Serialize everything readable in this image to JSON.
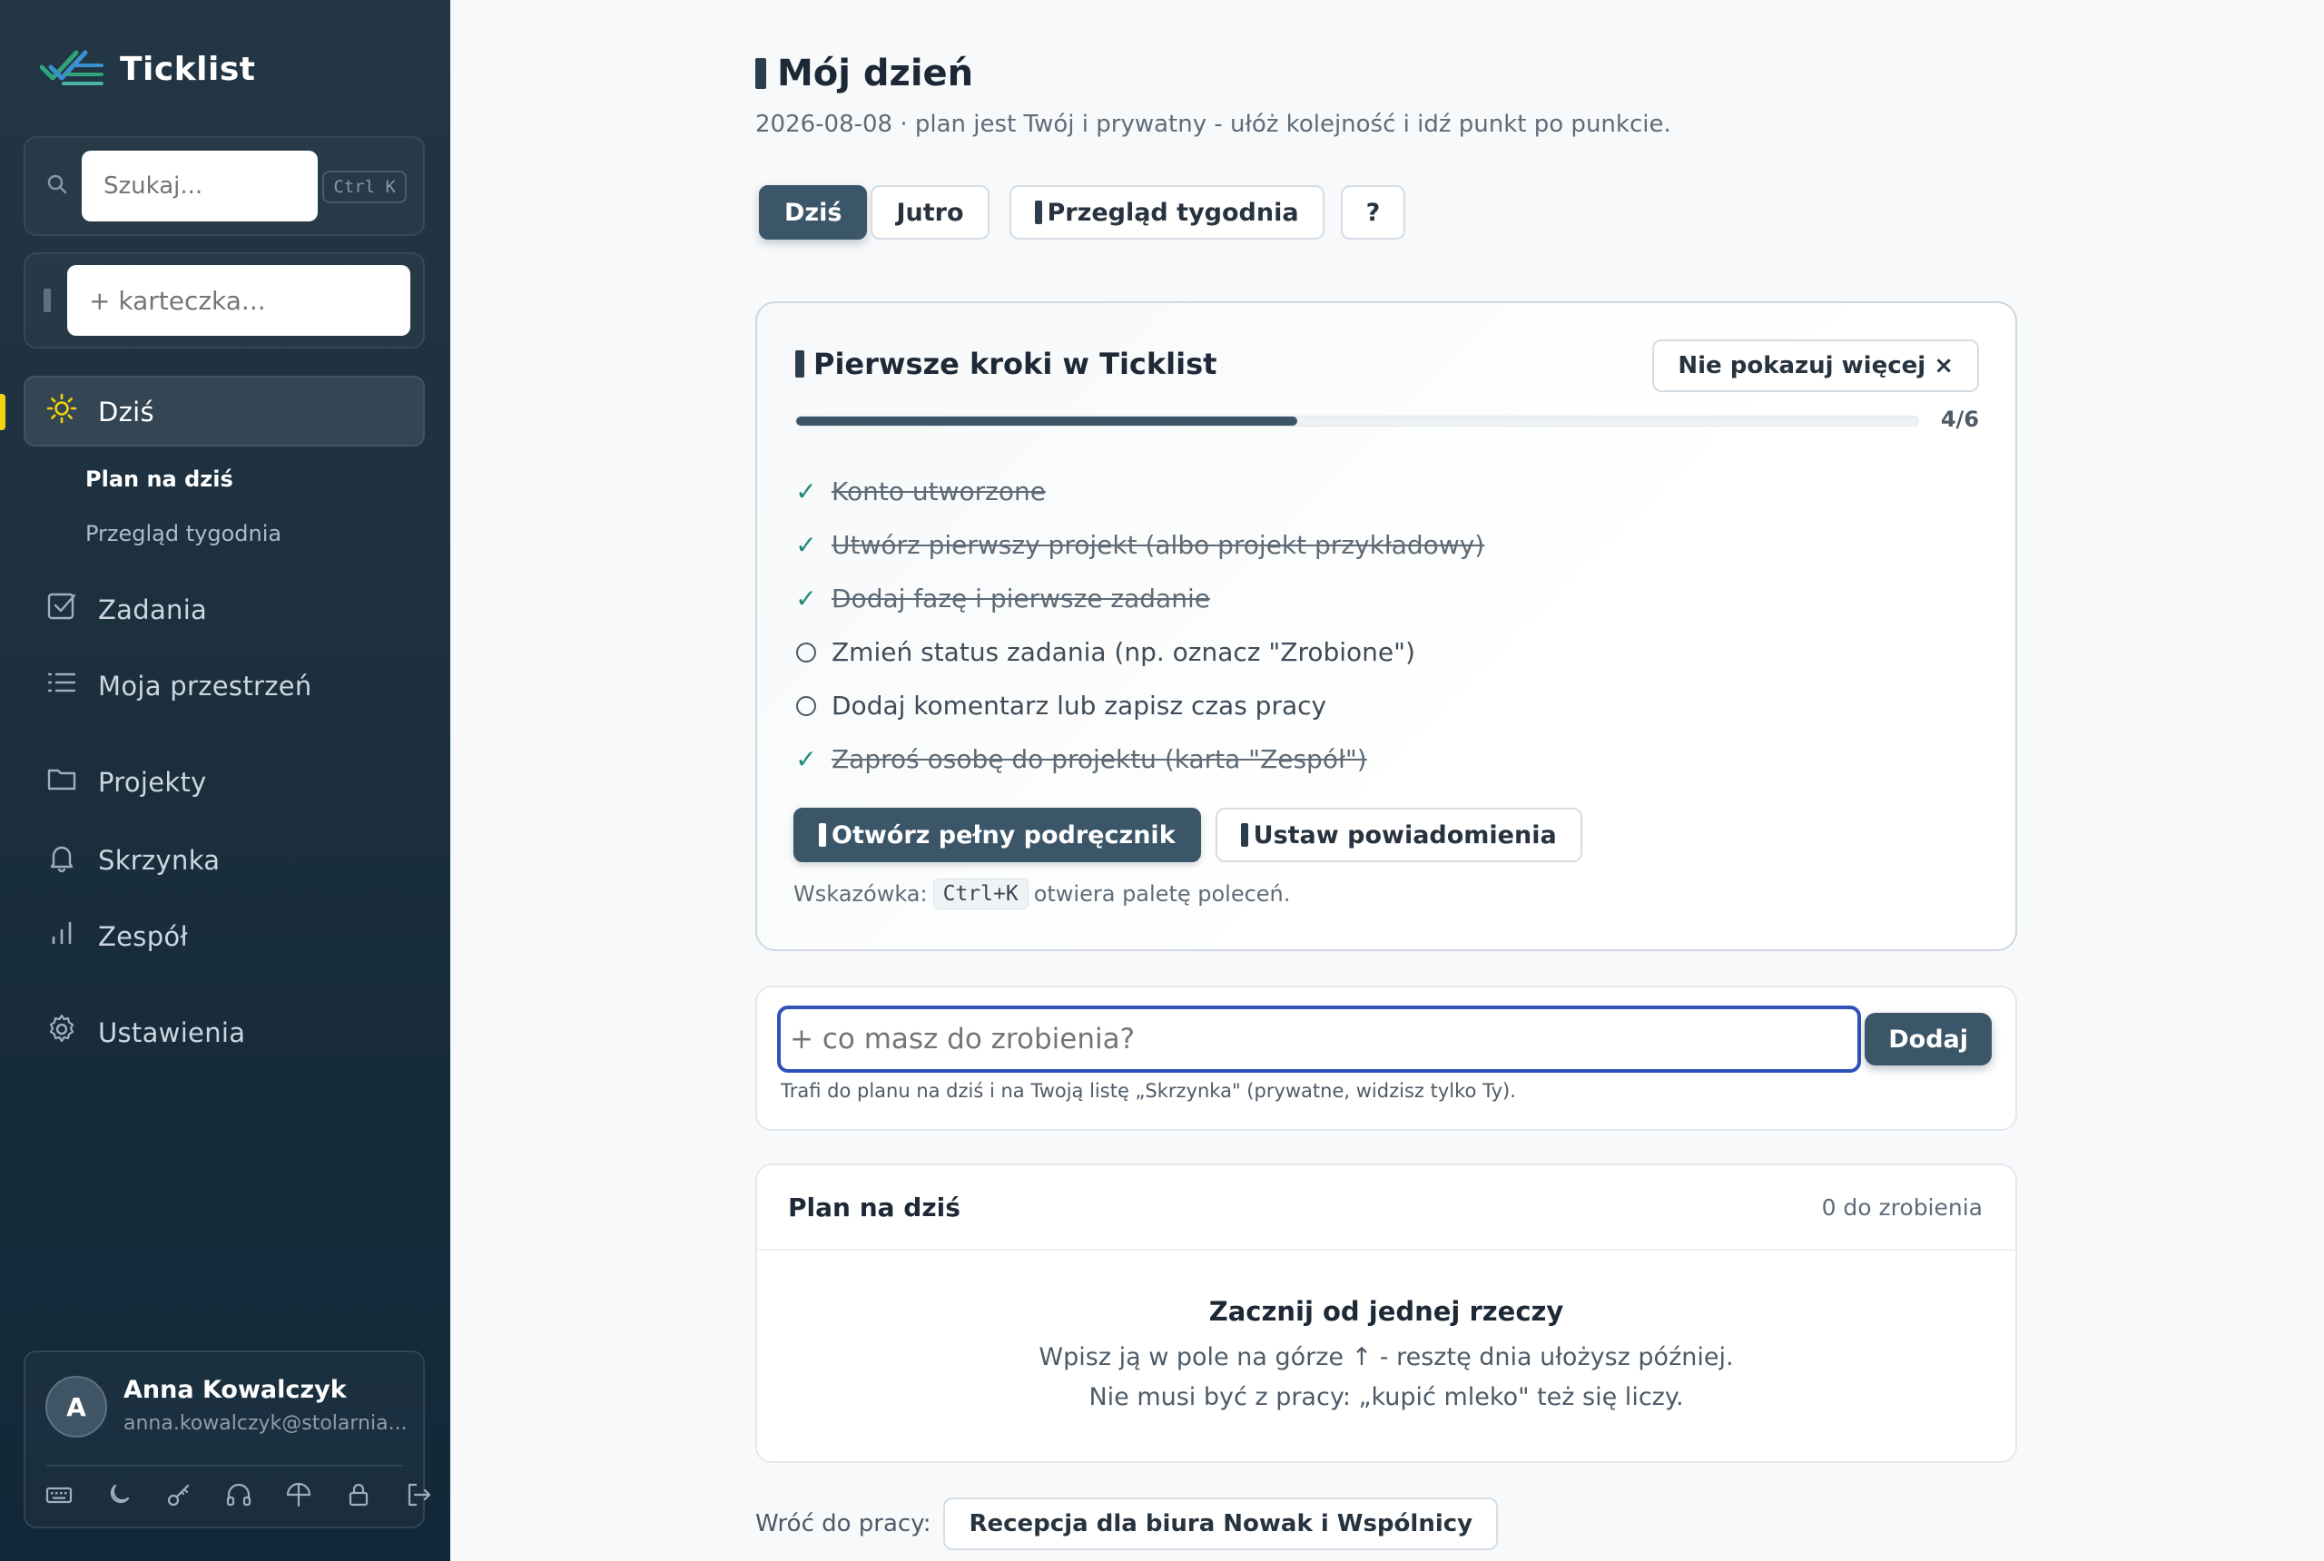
{
  "app": {
    "name": "Ticklist"
  },
  "sidebar": {
    "search": {
      "placeholder": "Szukaj...",
      "shortcut": "Ctrl K"
    },
    "quick_note": {
      "placeholder": "+ karteczka..."
    },
    "nav": {
      "today": "Dziś",
      "sub_plan": "Plan na dziś",
      "sub_review": "Przegląd tygodnia",
      "tasks": "Zadania",
      "workspace": "Moja przestrzeń",
      "projects": "Projekty",
      "inbox": "Skrzynka",
      "team": "Zespół",
      "settings": "Ustawienia"
    },
    "user": {
      "initial": "A",
      "name": "Anna Kowalczyk",
      "email": "anna.kowalczyk@stolarnia..."
    },
    "tools": [
      "keyboard-icon",
      "moon-icon",
      "key-icon",
      "headphones-icon",
      "umbrella-icon",
      "lock-icon",
      "logout-icon"
    ]
  },
  "header": {
    "title": "Mój dzień",
    "subtitle": "2026-08-08 · plan jest Twój i prywatny - ułóż kolejność i idź punkt po punkcie."
  },
  "tabs": {
    "today": "Dziś",
    "tomorrow": "Jutro",
    "week_review": "Przegląd tygodnia",
    "help": "?"
  },
  "onboarding": {
    "title": "Pierwsze kroki w Ticklist",
    "dismiss": "Nie pokazuj więcej ×",
    "progress": {
      "done": 4,
      "total": 6,
      "label": "4/6"
    },
    "steps": [
      {
        "text": "Konto utworzone",
        "done": true
      },
      {
        "text": "Utwórz pierwszy projekt (albo projekt przykładowy)",
        "done": true
      },
      {
        "text": "Dodaj fazę i pierwsze zadanie",
        "done": true
      },
      {
        "text": "Zmień status zadania (np. oznacz \"Zrobione\")",
        "done": false
      },
      {
        "text": "Dodaj komentarz lub zapisz czas pracy",
        "done": false
      },
      {
        "text": "Zaproś osobę do projektu (karta \"Zespół\")",
        "done": true
      }
    ],
    "check_glyph": "✓",
    "open_manual": "Otwórz pełny podręcznik",
    "set_notifications": "Ustaw powiadomienia",
    "hint_prefix": "Wskazówka:",
    "hint_key": "Ctrl+K",
    "hint_suffix": "otwiera paletę poleceń."
  },
  "quick_add": {
    "placeholder": "+ co masz do zrobienia?",
    "button": "Dodaj",
    "note": "Trafi do planu na dziś i na Twoją listę „Skrzynka\" (prywatne, widzisz tylko Ty)."
  },
  "plan": {
    "title": "Plan na dziś",
    "count": "0 do zrobienia",
    "empty_title": "Zacznij od jednej rzeczy",
    "empty_line1": "Wpisz ją w pole na górze ↑ - resztę dnia ułożysz później.",
    "empty_line2": "Nie musi być z pracy: „kupić mleko\" też się liczy."
  },
  "back_to_work": {
    "label": "Wróć do pracy:",
    "project": "Recepcja dla biura Nowak i Wspólnicy"
  },
  "colors": {
    "sidebar_bg": "#1b2f3d",
    "accent": "#3b5669",
    "active_marker": "#f2d20f",
    "done_check": "#1f8a78",
    "focus_ring": "#2f52b8"
  }
}
